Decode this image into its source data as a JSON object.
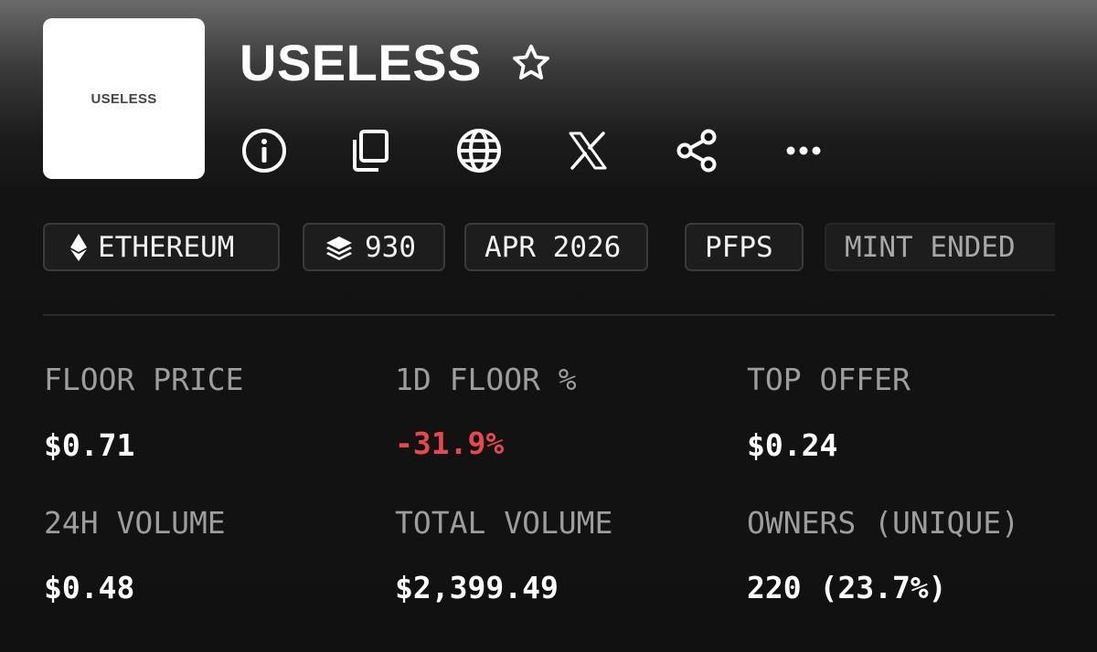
{
  "collection": {
    "logo_text": "USELESS",
    "name": "USELESS"
  },
  "actions": [
    {
      "icon": "info-icon"
    },
    {
      "icon": "copy-icon"
    },
    {
      "icon": "globe-icon"
    },
    {
      "icon": "x-logo-icon"
    },
    {
      "icon": "share-icon"
    },
    {
      "icon": "more-icon"
    }
  ],
  "tags": {
    "chain": "ETHEREUM",
    "supply": "930",
    "date": "APR 2026",
    "category": "PFPS",
    "mint_status": "MINT ENDED"
  },
  "stats": {
    "floor_price": {
      "label": "FLOOR PRICE",
      "value": "$0.71"
    },
    "floor_change_1d": {
      "label": "1D FLOOR %",
      "value": "-31.9%"
    },
    "top_offer": {
      "label": "TOP OFFER",
      "value": "$0.24"
    },
    "volume_24h": {
      "label": "24H VOLUME",
      "value": "$0.48"
    },
    "total_volume": {
      "label": "TOTAL VOLUME",
      "value": "$2,399.49"
    },
    "owners": {
      "label": "OWNERS (UNIQUE)",
      "value": "220 (23.7%)"
    }
  },
  "colors": {
    "negative": "#e5484d",
    "label": "#9d9d9d",
    "background": "#111111"
  }
}
